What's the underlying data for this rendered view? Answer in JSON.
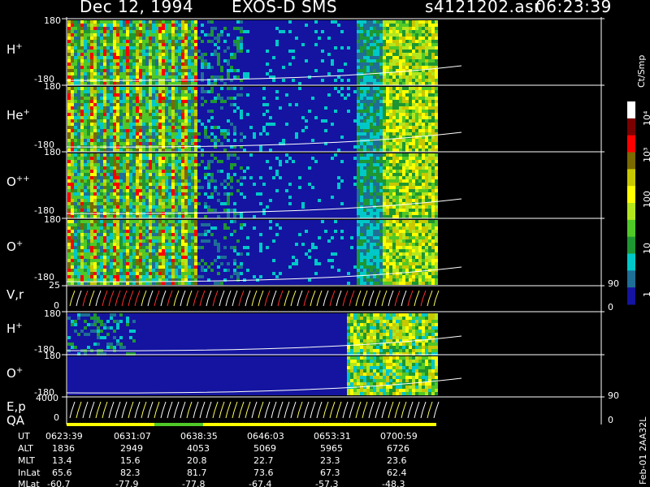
{
  "header": {
    "date": "Dec 12, 1994",
    "instrument": "EXOS-D SMS",
    "file": "s4121202.asr",
    "time": "06:23:39"
  },
  "panels": [
    {
      "key": "h_plus_1",
      "base": "H",
      "sup": "+",
      "top": "180",
      "bottom": "-180"
    },
    {
      "key": "he_plus",
      "base": "He",
      "sup": "+",
      "top": "180",
      "bottom": "-180"
    },
    {
      "key": "o_plus_plus",
      "base": "O",
      "sup": "++",
      "top": "180",
      "bottom": "-180"
    },
    {
      "key": "o_plus_1",
      "base": "O",
      "sup": "+",
      "top": "180",
      "bottom": "-180"
    },
    {
      "key": "v_r",
      "base": "V,r",
      "sup": "",
      "top": "25",
      "bottom": "0",
      "right_top": "90",
      "right_bottom": "0"
    },
    {
      "key": "h_plus_2",
      "base": "H",
      "sup": "+",
      "top": "180",
      "bottom": "-180"
    },
    {
      "key": "o_plus_2",
      "base": "O",
      "sup": "+",
      "top": "180",
      "bottom": "-180"
    },
    {
      "key": "e_p",
      "base": "E,p",
      "sup": "",
      "top": "4000",
      "bottom": "0",
      "right_top": "90",
      "right_bottom": "0"
    }
  ],
  "qa_label": "QA",
  "colorbar": {
    "label": "Ct/Smp",
    "ticks": [
      "10⁴",
      "10³",
      "100",
      "10",
      "1"
    ],
    "tick_values": [
      10000,
      1000,
      100,
      10,
      1
    ],
    "colors": [
      "#ffffff",
      "#7a0000",
      "#ff0000",
      "#7a6a00",
      "#c8c800",
      "#ffff00",
      "#b4e61e",
      "#50c828",
      "#1e9632",
      "#00c8c8",
      "#1e6e96",
      "#1414a0"
    ]
  },
  "footer": {
    "row_labels": [
      "UT",
      "ALT",
      "MLT",
      "InLat",
      "MLat"
    ],
    "columns": [
      [
        "0623:39",
        "1836",
        "13.4",
        "65.6",
        "-60.7"
      ],
      [
        "0631:07",
        "2949",
        "15.6",
        "82.3",
        "-77.9"
      ],
      [
        "0638:35",
        "4053",
        "20.8",
        "81.7",
        "-77.8"
      ],
      [
        "0646:03",
        "5069",
        "22.7",
        "73.6",
        "-67.4"
      ],
      [
        "0653:31",
        "5965",
        "23.3",
        "67.3",
        "-57.3"
      ],
      [
        "0700:59",
        "6726",
        "23.6",
        "62.4",
        "-48.3"
      ]
    ]
  },
  "stamp": "Feb-01 2AA32L",
  "chart_data": {
    "type": "heatmap",
    "x_axis": "UT",
    "x_ticks": [
      "0623:39",
      "0631:07",
      "0638:35",
      "0646:03",
      "0653:31",
      "0700:59"
    ],
    "z_label": "Ct/Smp",
    "z_scale": "log",
    "z_range": [
      1,
      10000
    ],
    "series": [
      {
        "name": "H+",
        "ylim": [
          -180,
          180
        ]
      },
      {
        "name": "He+",
        "ylim": [
          -180,
          180
        ]
      },
      {
        "name": "O++",
        "ylim": [
          -180,
          180
        ]
      },
      {
        "name": "O+",
        "ylim": [
          -180,
          180
        ]
      },
      {
        "name": "V,r",
        "ylim": [
          0,
          25
        ],
        "right_ylim": [
          0,
          90
        ]
      },
      {
        "name": "H+",
        "ylim": [
          -180,
          180
        ]
      },
      {
        "name": "O+",
        "ylim": [
          -180,
          180
        ]
      },
      {
        "name": "E,p",
        "ylim": [
          0,
          4000
        ],
        "right_ylim": [
          0,
          90
        ]
      }
    ]
  }
}
